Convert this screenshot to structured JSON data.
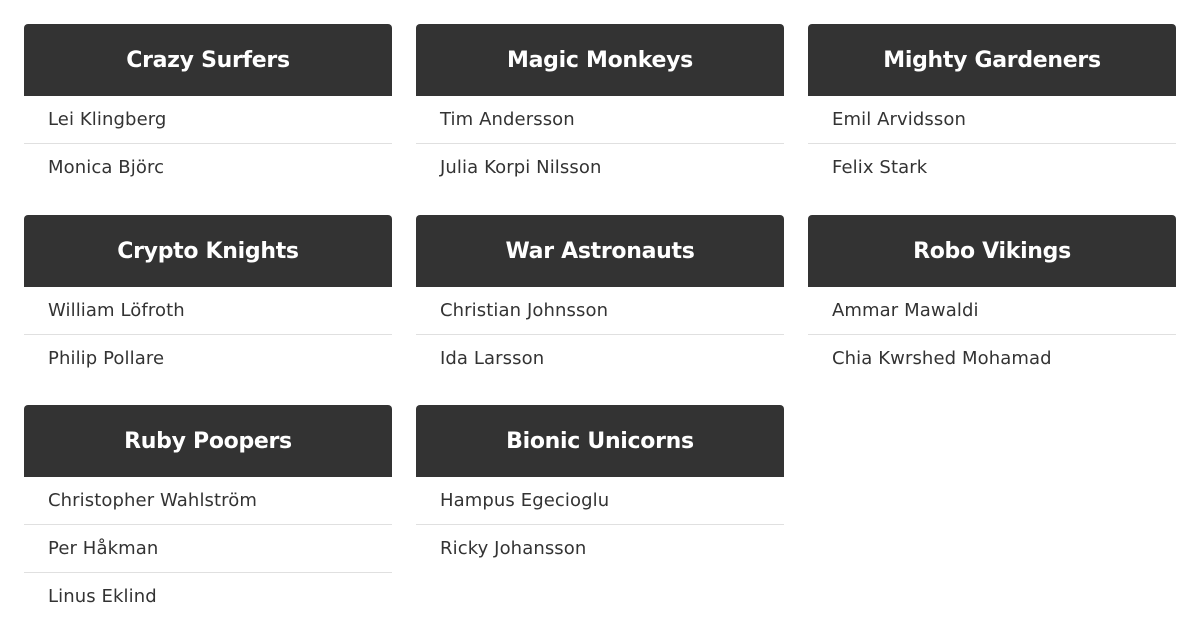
{
  "teams": [
    {
      "name": "Crazy Surfers",
      "members": [
        "Lei Klingberg",
        "Monica Björc"
      ]
    },
    {
      "name": "Magic Monkeys",
      "members": [
        "Tim Andersson",
        "Julia Korpi Nilsson"
      ]
    },
    {
      "name": "Mighty Gardeners",
      "members": [
        "Emil Arvidsson",
        "Felix Stark"
      ]
    },
    {
      "name": "Crypto Knights",
      "members": [
        "William Löfroth",
        "Philip Pollare"
      ]
    },
    {
      "name": "War Astronauts",
      "members": [
        "Christian Johnsson",
        "Ida Larsson"
      ]
    },
    {
      "name": "Robo Vikings",
      "members": [
        "Ammar Mawaldi",
        "Chia Kwrshed Mohamad"
      ]
    },
    {
      "name": "Ruby Poopers",
      "members": [
        "Christopher Wahlström",
        "Per Håkman",
        "Linus Eklind"
      ]
    },
    {
      "name": "Bionic Unicorns",
      "members": [
        "Hampus Egecioglu",
        "Ricky Johansson"
      ]
    }
  ],
  "colors": {
    "header_bg": "#333333",
    "header_text": "#ffffff",
    "member_text": "#333333",
    "divider": "#e0e0e0"
  }
}
